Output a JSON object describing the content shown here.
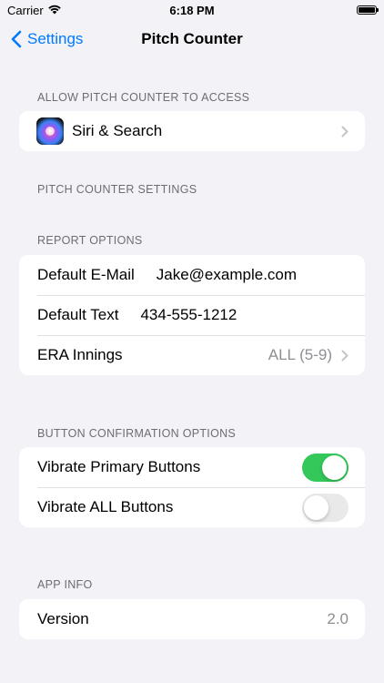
{
  "status_bar": {
    "carrier": "Carrier",
    "time": "6:18 PM"
  },
  "nav": {
    "back_label": "Settings",
    "title": "Pitch Counter"
  },
  "sections": {
    "access": {
      "header": "ALLOW PITCH COUNTER TO ACCESS",
      "siri_label": "Siri & Search"
    },
    "pitch_counter_settings": {
      "header": "PITCH COUNTER SETTINGS"
    },
    "report_options": {
      "header": "REPORT OPTIONS",
      "email_label": "Default E-Mail",
      "email_value": "Jake@example.com",
      "text_label": "Default Text",
      "text_value": "434-555-1212",
      "era_label": "ERA Innings",
      "era_value": "ALL (5-9)"
    },
    "button_confirmation": {
      "header": "BUTTON CONFIRMATION OPTIONS",
      "vibrate_primary_label": "Vibrate Primary Buttons",
      "vibrate_primary_on": true,
      "vibrate_all_label": "Vibrate ALL Buttons",
      "vibrate_all_on": false
    },
    "app_info": {
      "header": "APP INFO",
      "version_label": "Version",
      "version_value": "2.0"
    }
  },
  "colors": {
    "accent": "#007aff",
    "toggle_on": "#34c759",
    "background": "#f2f2f7"
  },
  "icons": [
    "wifi-icon",
    "battery-icon",
    "back-chevron-icon",
    "siri-icon",
    "chevron-right-icon"
  ]
}
